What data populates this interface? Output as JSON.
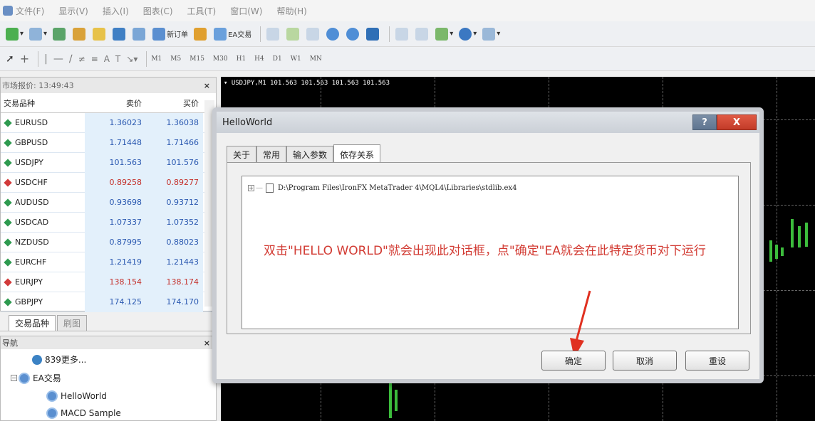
{
  "menubar": {
    "items": [
      "文件(F)",
      "显示(V)",
      "插入(I)",
      "图表(C)",
      "工具(T)",
      "窗口(W)",
      "帮助(H)"
    ]
  },
  "toolbar": {
    "new_order": "新订单",
    "ea_trading": "EA交易"
  },
  "timeframes": [
    "M1",
    "M5",
    "M15",
    "M30",
    "H1",
    "H4",
    "D1",
    "W1",
    "MN"
  ],
  "market_watch": {
    "title": "市场报价: 13:49:43",
    "columns": [
      "交易品种",
      "卖价",
      "买价"
    ],
    "rows": [
      {
        "symbol": "EURUSD",
        "bid": "1.36023",
        "ask": "1.36038",
        "dir": "up"
      },
      {
        "symbol": "GBPUSD",
        "bid": "1.71448",
        "ask": "1.71466",
        "dir": "up"
      },
      {
        "symbol": "USDJPY",
        "bid": "101.563",
        "ask": "101.576",
        "dir": "up"
      },
      {
        "symbol": "USDCHF",
        "bid": "0.89258",
        "ask": "0.89277",
        "dir": "down"
      },
      {
        "symbol": "AUDUSD",
        "bid": "0.93698",
        "ask": "0.93712",
        "dir": "up"
      },
      {
        "symbol": "USDCAD",
        "bid": "1.07337",
        "ask": "1.07352",
        "dir": "up"
      },
      {
        "symbol": "NZDUSD",
        "bid": "0.87995",
        "ask": "0.88023",
        "dir": "up"
      },
      {
        "symbol": "EURCHF",
        "bid": "1.21419",
        "ask": "1.21443",
        "dir": "up"
      },
      {
        "symbol": "EURJPY",
        "bid": "138.154",
        "ask": "138.174",
        "dir": "down"
      },
      {
        "symbol": "GBPJPY",
        "bid": "174.125",
        "ask": "174.170",
        "dir": "up"
      }
    ],
    "tabs": [
      "交易品种",
      "刷图"
    ]
  },
  "navigator": {
    "title": "导航",
    "items": [
      "839更多...",
      "EA交易",
      "HelloWorld",
      "MACD Sample"
    ]
  },
  "chart": {
    "title": "USDJPY,M1  101.563 101.563 101.563 101.563"
  },
  "dialog": {
    "title": "HelloWorld",
    "help": "?",
    "close": "X",
    "tabs": [
      "关于",
      "常用",
      "输入参数",
      "依存关系"
    ],
    "dependency": "D:\\Program Files\\IronFX MetaTrader 4\\MQL4\\Libraries\\stdlib.ex4",
    "annotation": "双击\"HELLO WORLD\"就会出现此对话框，点\"确定\"EA就会在此特定货币对下运行",
    "buttons": {
      "ok": "确定",
      "cancel": "取消",
      "reset": "重设"
    }
  },
  "colors": {
    "up": "#2e9a4f",
    "down": "#d23a3a",
    "annotation": "#d23a32",
    "price_blue": "#2a58b0"
  }
}
